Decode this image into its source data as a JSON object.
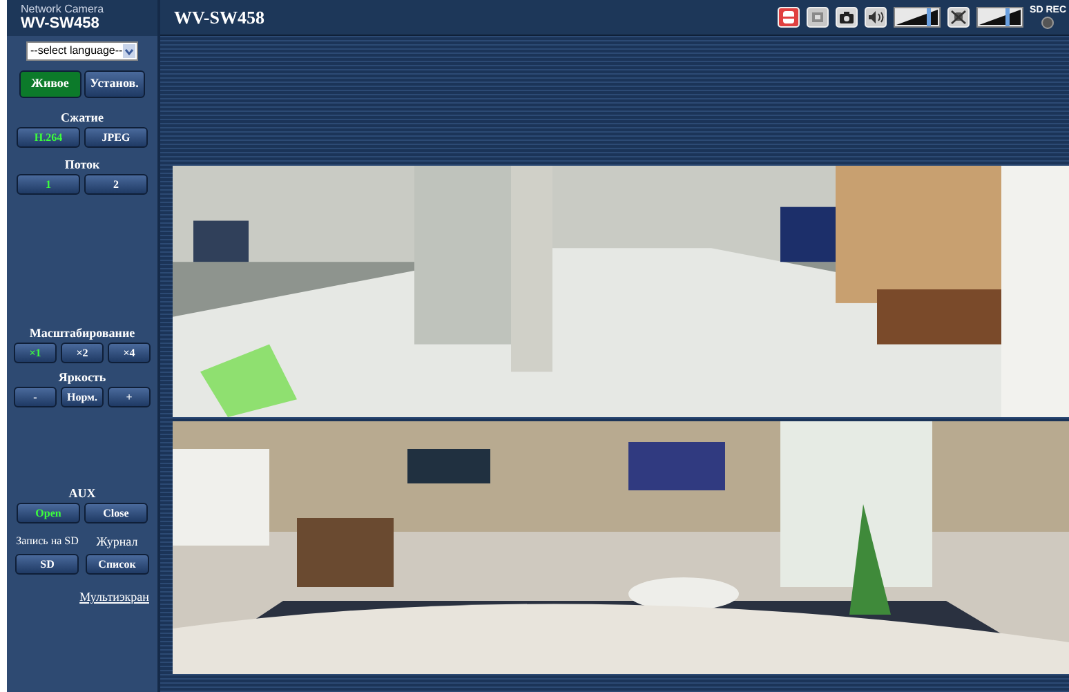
{
  "header": {
    "brand": "Network Camera",
    "model": "WV-SW458",
    "title": "WV-SW458"
  },
  "language": {
    "value": "--select language--"
  },
  "mode_tabs": [
    {
      "label": "Живое",
      "selected": true
    },
    {
      "label": "Установ.",
      "selected": false
    }
  ],
  "control_groups": [
    {
      "heading": "Сжатие",
      "buttons": [
        {
          "label": "H.264",
          "selected": true
        },
        {
          "label": "JPEG",
          "selected": false
        }
      ]
    },
    {
      "heading": "Поток",
      "buttons": [
        {
          "label": "1",
          "selected": true
        },
        {
          "label": "2",
          "selected": false
        }
      ]
    },
    {
      "heading": "Масштабирование",
      "buttons": [
        {
          "label": "×1",
          "selected": true
        },
        {
          "label": "×2",
          "selected": false
        },
        {
          "label": "×4",
          "selected": false
        }
      ]
    },
    {
      "heading": "Яркость",
      "buttons": [
        {
          "label": "-",
          "selected": false
        },
        {
          "label": "Норм.",
          "selected": false
        },
        {
          "label": "+",
          "selected": false
        }
      ]
    },
    {
      "heading": "AUX",
      "buttons": [
        {
          "label": "Open",
          "selected": true
        },
        {
          "label": "Close",
          "selected": false
        }
      ]
    }
  ],
  "sd_group": {
    "heading": "Запись на SD",
    "button": "SD"
  },
  "log_group": {
    "heading": "Журнал",
    "button": "Список"
  },
  "multiscreen_link": "Мультиэкран",
  "toolbar": {
    "speaker_volume": {
      "level": 0.8
    },
    "mic_volume": {
      "level": 0.7
    },
    "sd_rec_label": "SD REC"
  }
}
